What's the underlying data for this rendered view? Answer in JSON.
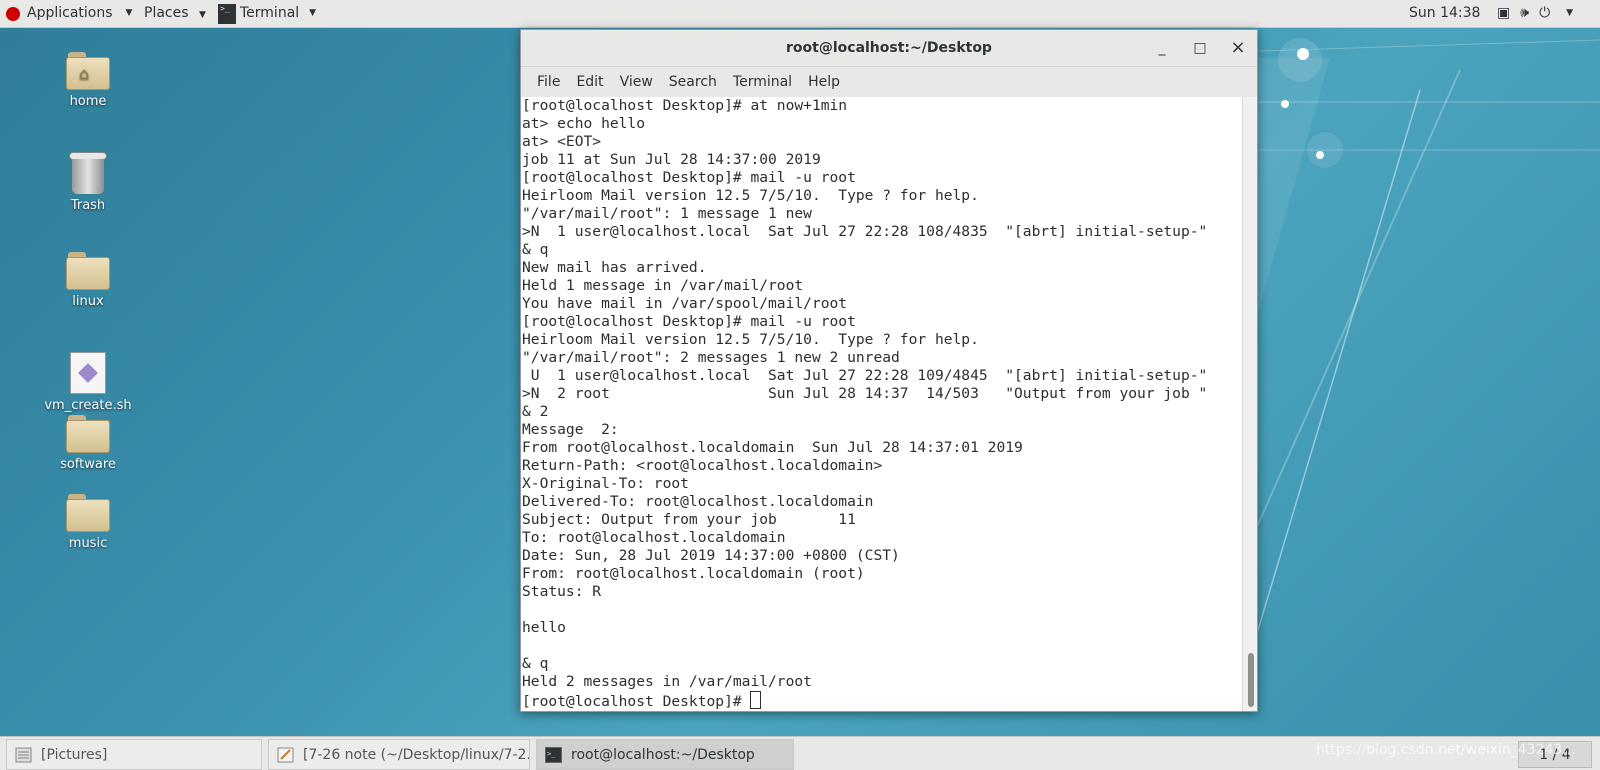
{
  "topbar": {
    "applications": "Applications",
    "places": "Places",
    "terminal": "Terminal",
    "clock": "Sun 14:38",
    "icons": [
      "screen-icon",
      "volume-icon",
      "power-icon"
    ]
  },
  "desktop": {
    "icons": [
      {
        "label": "home"
      },
      {
        "label": "Trash"
      },
      {
        "label": "linux"
      },
      {
        "label": "vm_create.sh"
      },
      {
        "label": "software"
      },
      {
        "label": "music"
      }
    ]
  },
  "window": {
    "title": "root@localhost:~/Desktop",
    "controls": {
      "minimize": "_",
      "maximize": "□",
      "close": "×"
    },
    "menu": [
      "File",
      "Edit",
      "View",
      "Search",
      "Terminal",
      "Help"
    ],
    "lines": [
      "[root@localhost Desktop]# at now+1min",
      "at> echo hello",
      "at> <EOT>",
      "job 11 at Sun Jul 28 14:37:00 2019",
      "[root@localhost Desktop]# mail -u root",
      "Heirloom Mail version 12.5 7/5/10.  Type ? for help.",
      "\"/var/mail/root\": 1 message 1 new",
      ">N  1 user@localhost.local  Sat Jul 27 22:28 108/4835  \"[abrt] initial-setup-\"",
      "& q",
      "New mail has arrived.",
      "Held 1 message in /var/mail/root",
      "You have mail in /var/spool/mail/root",
      "[root@localhost Desktop]# mail -u root",
      "Heirloom Mail version 12.5 7/5/10.  Type ? for help.",
      "\"/var/mail/root\": 2 messages 1 new 2 unread",
      " U  1 user@localhost.local  Sat Jul 27 22:28 109/4845  \"[abrt] initial-setup-\"",
      ">N  2 root                  Sun Jul 28 14:37  14/503   \"Output from your job \"",
      "& 2",
      "Message  2:",
      "From root@localhost.localdomain  Sun Jul 28 14:37:01 2019",
      "Return-Path: <root@localhost.localdomain>",
      "X-Original-To: root",
      "Delivered-To: root@localhost.localdomain",
      "Subject: Output from your job       11",
      "To: root@localhost.localdomain",
      "Date: Sun, 28 Jul 2019 14:37:00 +0800 (CST)",
      "From: root@localhost.localdomain (root)",
      "Status: R",
      "",
      "hello",
      "",
      "& q",
      "Held 2 messages in /var/mail/root"
    ],
    "prompt": "[root@localhost Desktop]# "
  },
  "taskbar": {
    "tasks": [
      {
        "label": "[Pictures]"
      },
      {
        "label": "[7-26 note (~/Desktop/linux/7-2..."
      },
      {
        "label": "root@localhost:~/Desktop"
      }
    ],
    "workspace": "1 / 4",
    "watermark": "https://blog.csdn.net/weixin_43243..."
  }
}
